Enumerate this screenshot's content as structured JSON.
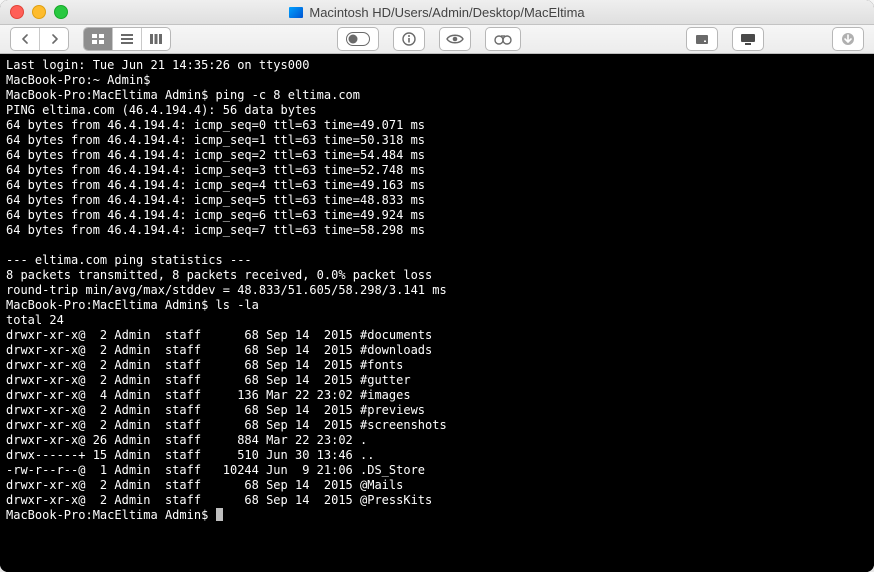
{
  "title": "Macintosh HD/Users/Admin/Desktop/MacEltima",
  "last_login": "Last login: Tue Jun 21 14:35:26 on ttys000",
  "prompt_home": "MacBook-Pro:~ Admin$ ",
  "prompt_dir": "MacBook-Pro:MacEltima Admin$ ",
  "cmd_ping": "ping -c 8 eltima.com",
  "ping_header": "PING eltima.com (46.4.194.4): 56 data bytes",
  "ping_ip": "46.4.194.4",
  "ping_ttl": "63",
  "ping_seq": [
    {
      "seq": "0",
      "time": "49.071"
    },
    {
      "seq": "1",
      "time": "50.318"
    },
    {
      "seq": "2",
      "time": "54.484"
    },
    {
      "seq": "3",
      "time": "52.748"
    },
    {
      "seq": "4",
      "time": "49.163"
    },
    {
      "seq": "5",
      "time": "48.833"
    },
    {
      "seq": "6",
      "time": "49.924"
    },
    {
      "seq": "7",
      "time": "58.298"
    }
  ],
  "ping_stats_hdr": "--- eltima.com ping statistics ---",
  "ping_stats_summary": "8 packets transmitted, 8 packets received, 0.0% packet loss",
  "ping_stats_rt": "round-trip min/avg/max/stddev = 48.833/51.605/58.298/3.141 ms",
  "cmd_ls": "ls -la",
  "ls_total": "total 24",
  "ls": [
    {
      "perm": "drwxr-xr-x@",
      "links": " 2",
      "owner": "Admin",
      "group": "staff",
      "size": "    68",
      "date": "Sep 14  2015",
      "name": "#documents"
    },
    {
      "perm": "drwxr-xr-x@",
      "links": " 2",
      "owner": "Admin",
      "group": "staff",
      "size": "    68",
      "date": "Sep 14  2015",
      "name": "#downloads"
    },
    {
      "perm": "drwxr-xr-x@",
      "links": " 2",
      "owner": "Admin",
      "group": "staff",
      "size": "    68",
      "date": "Sep 14  2015",
      "name": "#fonts"
    },
    {
      "perm": "drwxr-xr-x@",
      "links": " 2",
      "owner": "Admin",
      "group": "staff",
      "size": "    68",
      "date": "Sep 14  2015",
      "name": "#gutter"
    },
    {
      "perm": "drwxr-xr-x@",
      "links": " 4",
      "owner": "Admin",
      "group": "staff",
      "size": "   136",
      "date": "Mar 22 23:02",
      "name": "#images"
    },
    {
      "perm": "drwxr-xr-x@",
      "links": " 2",
      "owner": "Admin",
      "group": "staff",
      "size": "    68",
      "date": "Sep 14  2015",
      "name": "#previews"
    },
    {
      "perm": "drwxr-xr-x@",
      "links": " 2",
      "owner": "Admin",
      "group": "staff",
      "size": "    68",
      "date": "Sep 14  2015",
      "name": "#screenshots"
    },
    {
      "perm": "drwxr-xr-x@",
      "links": "26",
      "owner": "Admin",
      "group": "staff",
      "size": "   884",
      "date": "Mar 22 23:02",
      "name": "."
    },
    {
      "perm": "drwx------+",
      "links": "15",
      "owner": "Admin",
      "group": "staff",
      "size": "   510",
      "date": "Jun 30 13:46",
      "name": ".."
    },
    {
      "perm": "-rw-r--r--@",
      "links": " 1",
      "owner": "Admin",
      "group": "staff",
      "size": " 10244",
      "date": "Jun  9 21:06",
      "name": ".DS_Store"
    },
    {
      "perm": "drwxr-xr-x@",
      "links": " 2",
      "owner": "Admin",
      "group": "staff",
      "size": "    68",
      "date": "Sep 14  2015",
      "name": "@Mails"
    },
    {
      "perm": "drwxr-xr-x@",
      "links": " 2",
      "owner": "Admin",
      "group": "staff",
      "size": "    68",
      "date": "Sep 14  2015",
      "name": "@PressKits"
    }
  ]
}
